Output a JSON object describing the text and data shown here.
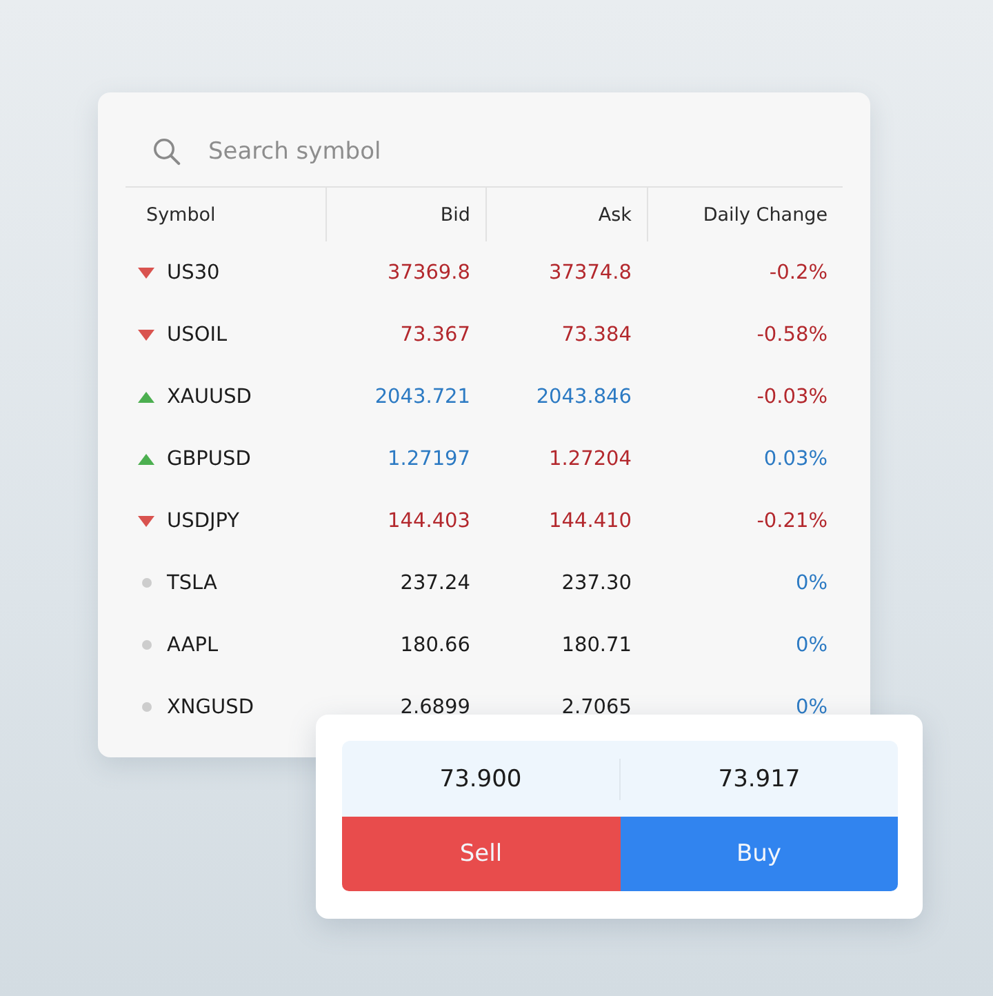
{
  "search": {
    "placeholder": "Search symbol"
  },
  "table": {
    "columns": [
      "Symbol",
      "Bid",
      "Ask",
      "Daily Change"
    ],
    "rows": [
      {
        "symbol": "US30",
        "kind": "down",
        "bid": {
          "text": "37369.8",
          "color": "#b3282d"
        },
        "ask": {
          "text": "37374.8",
          "color": "#b3282d"
        },
        "change": {
          "text": "-0.2%",
          "color": "#b3282d"
        }
      },
      {
        "symbol": "USOIL",
        "kind": "down",
        "bid": {
          "text": "73.367",
          "color": "#b3282d"
        },
        "ask": {
          "text": "73.384",
          "color": "#b3282d"
        },
        "change": {
          "text": "-0.58%",
          "color": "#b3282d"
        }
      },
      {
        "symbol": "XAUUSD",
        "kind": "up",
        "bid": {
          "text": "2043.721",
          "color": "#2c7ac3"
        },
        "ask": {
          "text": "2043.846",
          "color": "#2c7ac3"
        },
        "change": {
          "text": "-0.03%",
          "color": "#b3282d"
        }
      },
      {
        "symbol": "GBPUSD",
        "kind": "up",
        "bid": {
          "text": "1.27197",
          "color": "#2c7ac3"
        },
        "ask": {
          "text": "1.27204",
          "color": "#b3282d"
        },
        "change": {
          "text": "0.03%",
          "color": "#2c7ac3"
        }
      },
      {
        "symbol": "USDJPY",
        "kind": "down",
        "bid": {
          "text": "144.403",
          "color": "#b3282d"
        },
        "ask": {
          "text": "144.410",
          "color": "#b3282d"
        },
        "change": {
          "text": "-0.21%",
          "color": "#b3282d"
        }
      },
      {
        "symbol": "TSLA",
        "kind": "flat",
        "bid": {
          "text": "237.24",
          "color": "#1c1c1c"
        },
        "ask": {
          "text": "237.30",
          "color": "#1c1c1c"
        },
        "change": {
          "text": "0%",
          "color": "#2c7ac3"
        }
      },
      {
        "symbol": "AAPL",
        "kind": "flat",
        "bid": {
          "text": "180.66",
          "color": "#1c1c1c"
        },
        "ask": {
          "text": "180.71",
          "color": "#1c1c1c"
        },
        "change": {
          "text": "0%",
          "color": "#2c7ac3"
        }
      },
      {
        "symbol": "XNGUSD",
        "kind": "flat",
        "bid": {
          "text": "2.6899",
          "color": "#1c1c1c"
        },
        "ask": {
          "text": "2.7065",
          "color": "#1c1c1c"
        },
        "change": {
          "text": "0%",
          "color": "#2c7ac3"
        }
      }
    ]
  },
  "trade_panel": {
    "bid": "73.900",
    "ask": "73.917",
    "buttons": [
      {
        "label": "Sell",
        "kind": "sell"
      },
      {
        "label": "Buy",
        "kind": "buy"
      }
    ]
  }
}
